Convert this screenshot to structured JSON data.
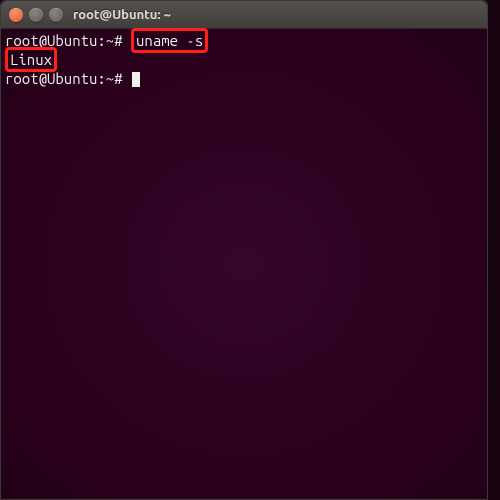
{
  "window": {
    "title": "root@Ubuntu: ~"
  },
  "terminal": {
    "line1_prompt": "root@Ubuntu:~#",
    "line1_command": "uname -s",
    "line2_output": "Linux",
    "line3_prompt": "root@Ubuntu:~#"
  },
  "highlights": {
    "command_box": true,
    "output_box": true
  },
  "colors": {
    "terminal_bg": "#2c001e",
    "text": "#eeeeec",
    "highlight_border": "#ff2119",
    "close_button": "#e5541f"
  }
}
